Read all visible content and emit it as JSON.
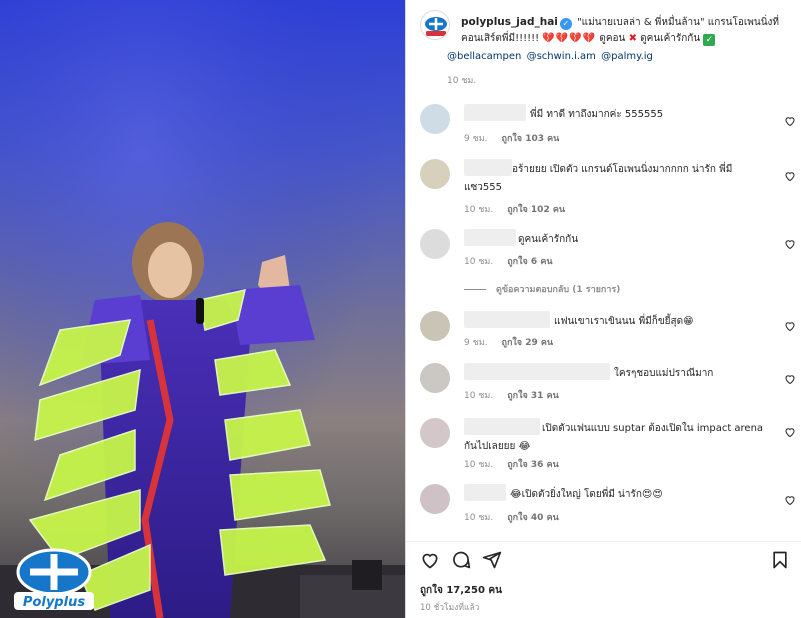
{
  "photo": {
    "alt": "Performer on stage in a purple gown with layered green panels",
    "logo_text": "Polyplus"
  },
  "post": {
    "username": "polyplus_jad_hai",
    "caption_line1": "\"แม่นายเบลล่า & พี่หมื่นล้าน\" แกรนโอเพนนิ่งที่",
    "caption_line2a": "คอนเสิร์ตพี่มี!!!!!!",
    "caption_hearts": "💔💔💔💔",
    "caption_line2b": "ดูคอน",
    "caption_xmark": "✖",
    "caption_line2c": "ดูคนเค้ารักกัน",
    "caption_check": "✓",
    "mentions": "@bellacampen @schwin.i.am @palmy.ig",
    "time": "10 ชม.",
    "comments": [
      {
        "text": "พี่มี ทาดี ทาถึงมากค่ะ 555555",
        "time": "9 ชม.",
        "likes": "ถูกใจ 103 คน"
      },
      {
        "text": "อร้ายยย เปิดตัว แกรนด์โอเพนนิ่งมากกกก น่ารัก พี่มีแซว555",
        "time": "10 ชม.",
        "likes": "ถูกใจ 102 คน"
      },
      {
        "text": "ดูคนเค้ารักกัน",
        "time": "10 ชม.",
        "likes": "ถูกใจ 6 คน"
      },
      {
        "text": "แฟนเขาเราเขินนน พี่มีก็ขยี้สุด😁",
        "time": "9 ชม.",
        "likes": "ถูกใจ 29 คน"
      },
      {
        "text": "ใครๆชอบแม่ปราณีมาก",
        "time": "10 ชม.",
        "likes": "ถูกใจ 31 คน"
      },
      {
        "text": "เปิดตัวแฟนแบบ suptar ต้องเปิดใน impact arena กันไปเลยยย 😂",
        "time": "10 ชม.",
        "likes": "ถูกใจ 36 คน"
      },
      {
        "text": "😂เปิดตัวยิ่งใหญ่ โดยพี่มี น่ารัก😍😍",
        "time": "10 ชม.",
        "likes": "ถูกใจ 40 คน"
      }
    ],
    "view_replies": "ดูข้อความตอบกลับ (1 รายการ)",
    "total_likes": "ถูกใจ 17,250 คน",
    "post_time": "10 ชั่วโมงที่แล้ว",
    "colors": {
      "link": "#00376b",
      "muted": "#8e8e8e",
      "text": "#262626",
      "verified": "#3897f0"
    },
    "icons": [
      "heart-icon",
      "comment-icon",
      "share-icon",
      "bookmark-icon"
    ]
  }
}
